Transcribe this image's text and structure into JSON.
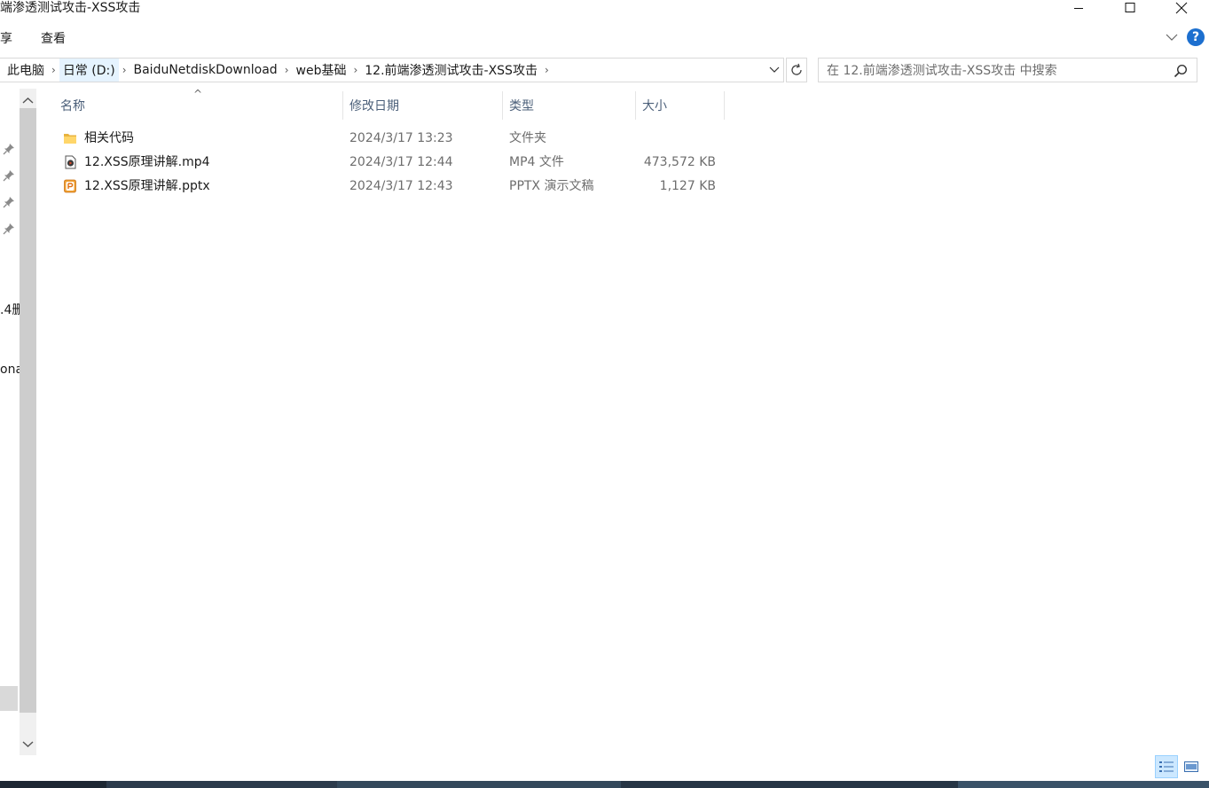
{
  "window": {
    "title": "端渗透测试攻击-XSS攻击",
    "colors": {
      "accent": "#1c6fcf",
      "selection": "#cce8ff",
      "header_text": "#4c607a"
    }
  },
  "ribbon": {
    "tabs": [
      {
        "label": "享"
      },
      {
        "label": "查看"
      }
    ],
    "help_label": "?"
  },
  "address": {
    "crumbs": [
      {
        "label": "此电脑"
      },
      {
        "label": "日常 (D:)"
      },
      {
        "label": "BaiduNetdiskDownload"
      },
      {
        "label": "web基础"
      },
      {
        "label": "12.前端渗透测试攻击-XSS攻击"
      }
    ]
  },
  "search": {
    "placeholder": "在 12.前端渗透测试攻击-XSS攻击 中搜索",
    "value": ""
  },
  "navpane": {
    "fragments": [
      {
        "label": ".4删"
      },
      {
        "label": "ona"
      }
    ]
  },
  "columns": {
    "name": "名称",
    "date": "修改日期",
    "type": "类型",
    "size": "大小"
  },
  "files": [
    {
      "name": "相关代码",
      "date": "2024/3/17 13:23",
      "type": "文件夹",
      "size": "",
      "icon": "folder-icon"
    },
    {
      "name": "12.XSS原理讲解.mp4",
      "date": "2024/3/17 12:44",
      "type": "MP4 文件",
      "size": "473,572 KB",
      "icon": "video-file-icon"
    },
    {
      "name": "12.XSS原理讲解.pptx",
      "date": "2024/3/17 12:43",
      "type": "PPTX 演示文稿",
      "size": "1,127 KB",
      "icon": "pptx-file-icon"
    }
  ]
}
